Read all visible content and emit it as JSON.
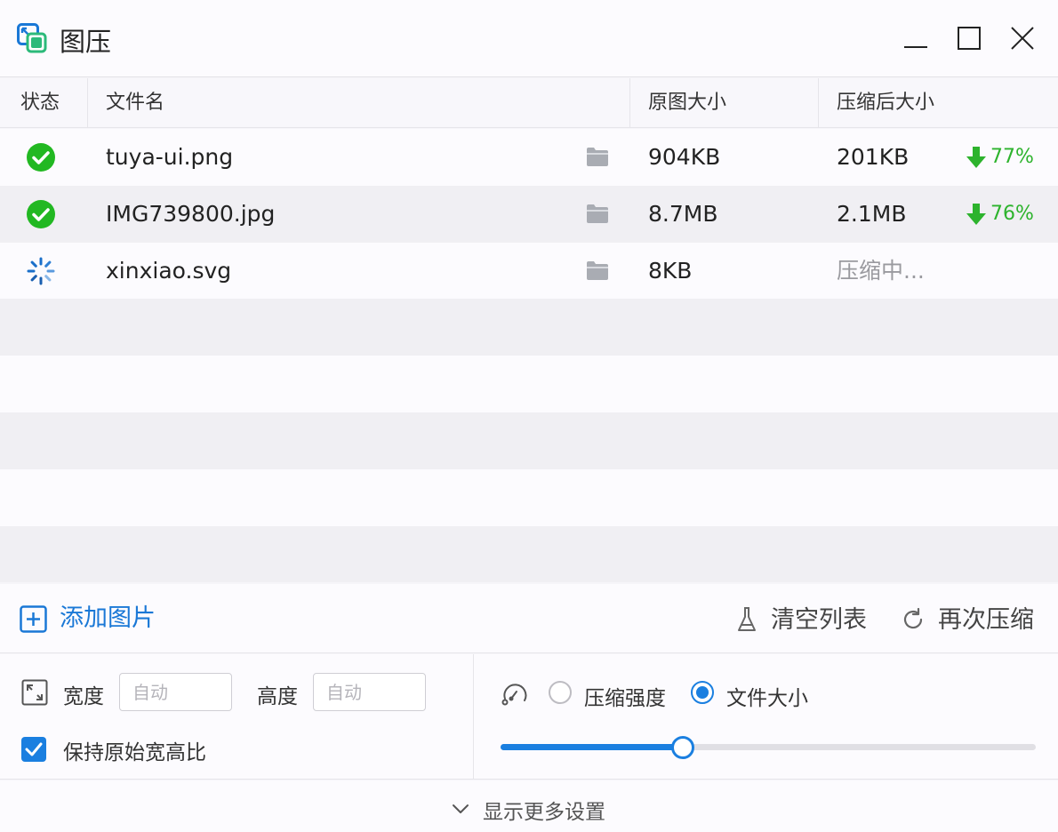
{
  "window": {
    "title": "图压",
    "controls": [
      "minimize-icon",
      "maximize-icon",
      "close-icon"
    ]
  },
  "table": {
    "headers": {
      "status": "状态",
      "filename": "文件名",
      "original_size": "原图大小",
      "compressed_size": "压缩后大小"
    },
    "rows": [
      {
        "status": "done",
        "filename": "tuya-ui.png",
        "original_size": "904KB",
        "compressed_size": "201KB",
        "reduction": "77%"
      },
      {
        "status": "done",
        "filename": "IMG739800.jpg",
        "original_size": "8.7MB",
        "compressed_size": "2.1MB",
        "reduction": "76%"
      },
      {
        "status": "loading",
        "filename": "xinxiao.svg",
        "original_size": "8KB",
        "compressed_size": "压缩中...",
        "reduction": ""
      }
    ],
    "empty_row_count": 5
  },
  "actions": {
    "add_label": "添加图片",
    "clear_label": "清空列表",
    "recompress_label": "再次压缩"
  },
  "settings": {
    "width_label": "宽度",
    "width_placeholder": "自动",
    "height_label": "高度",
    "height_placeholder": "自动",
    "keep_ratio_label": "保持原始宽高比",
    "keep_ratio_checked": true,
    "mode_strength_label": "压缩强度",
    "mode_size_label": "文件大小",
    "selected_mode": "文件大小",
    "slider_level": 0.34
  },
  "footer": {
    "more_label": "显示更多设置"
  },
  "colors": {
    "accent": "#1a7fe0",
    "success": "#2db32d",
    "row_alt": "#f0eff3"
  }
}
